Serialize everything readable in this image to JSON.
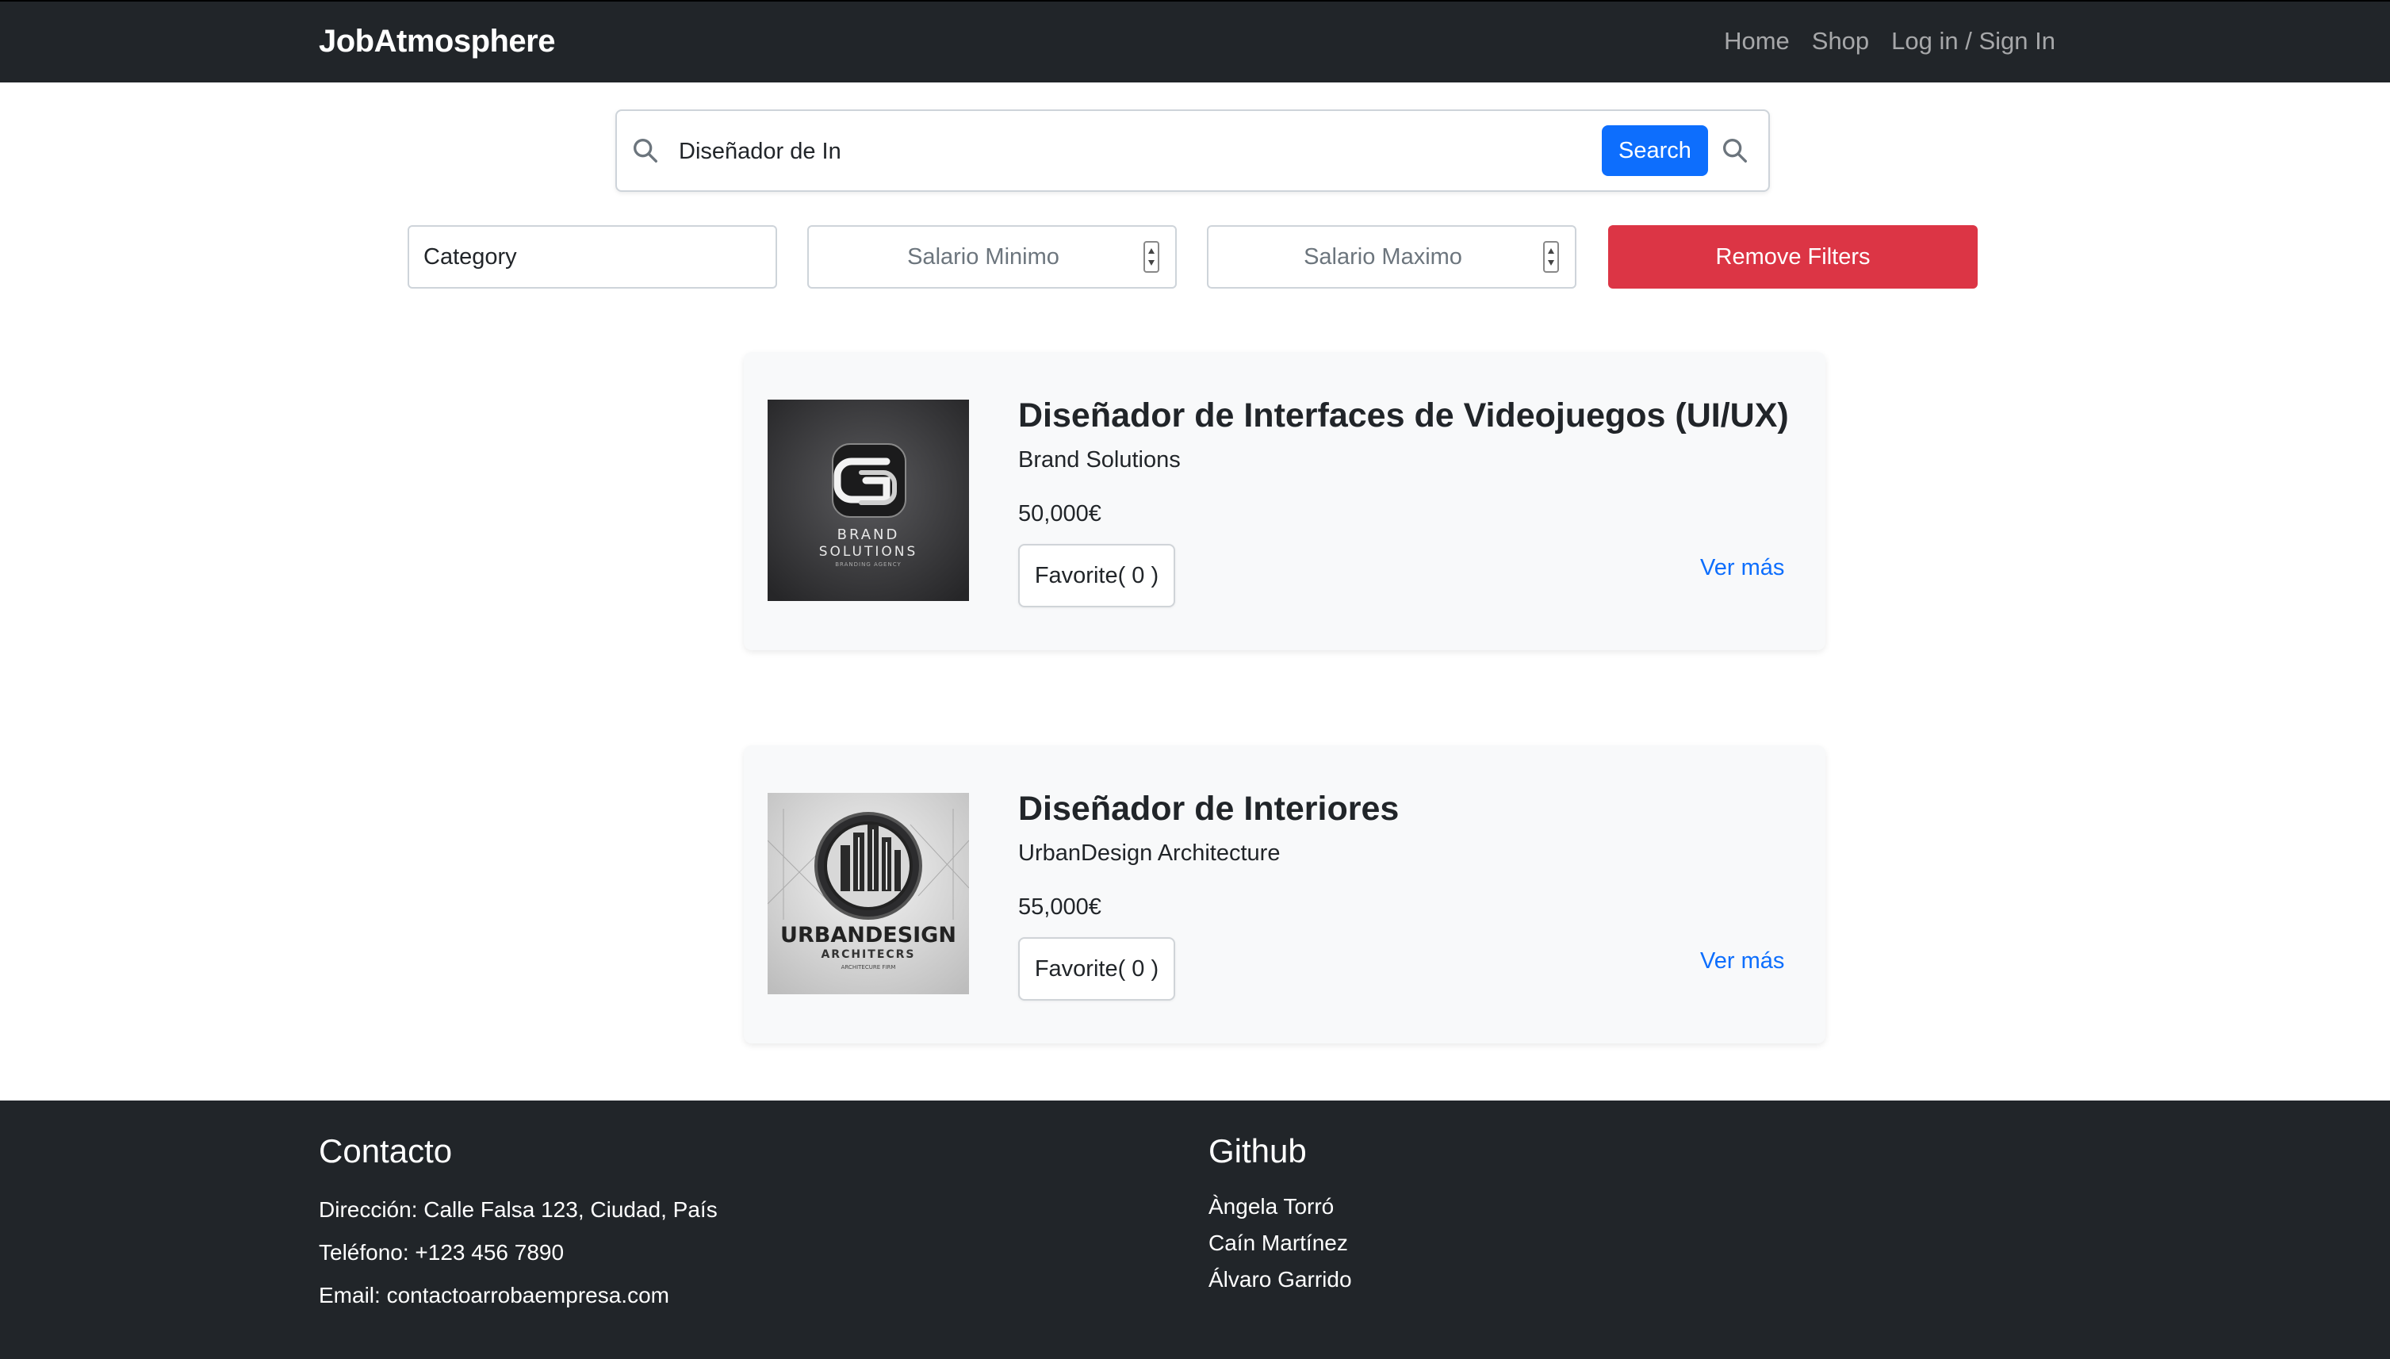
{
  "navbar": {
    "brand": "JobAtmosphere",
    "links": [
      "Home",
      "Shop",
      "Log in / Sign In"
    ]
  },
  "search": {
    "value": "Diseñador de In",
    "button_label": "Search"
  },
  "filters": {
    "category": "Category",
    "salary_min_placeholder": "Salario Minimo",
    "salary_max_placeholder": "Salario Maximo",
    "remove_label": "Remove Filters"
  },
  "jobs": [
    {
      "title": "Diseñador de Interfaces de Videojuegos (UI/UX)",
      "company": "Brand Solutions",
      "salary": "50,000€",
      "favorite_label": "Favorite( 0 )",
      "more_label": "Ver más",
      "logo": {
        "line1": "BRAND",
        "line2": "SOLUTIONS",
        "line3": "BRANDING AGENCY"
      }
    },
    {
      "title": "Diseñador de Interiores",
      "company": "UrbanDesign Architecture",
      "salary": "55,000€",
      "favorite_label": "Favorite( 0 )",
      "more_label": "Ver más",
      "logo": {
        "line1": "URBANDESIGN",
        "line2": "ARCHITECRS",
        "line3": "ARCHITECURE FIRM"
      }
    }
  ],
  "footer": {
    "contact": {
      "heading": "Contacto",
      "address": "Dirección: Calle Falsa 123, Ciudad, País",
      "phone": "Teléfono: +123 456 7890",
      "email": "Email: contactoarrobaempresa.com"
    },
    "github": {
      "heading": "Github",
      "members": [
        "Àngela Torró",
        "Caín Martínez",
        "Álvaro Garrido"
      ]
    }
  },
  "colors": {
    "navbar_bg": "#212529",
    "primary": "#0d6efd",
    "danger": "#dc3545",
    "card_bg": "#f8f9fa"
  }
}
